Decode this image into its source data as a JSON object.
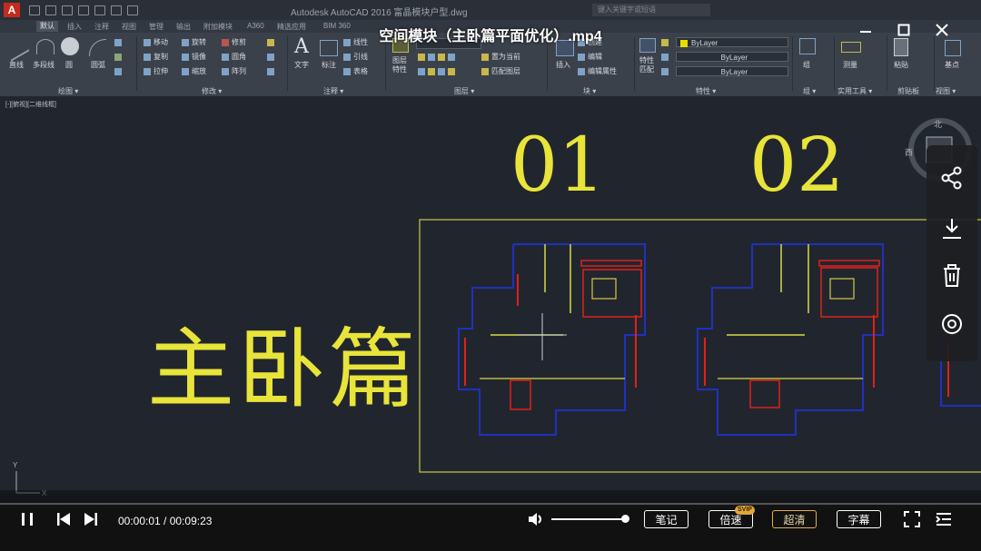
{
  "app": {
    "logo": "A",
    "window_title": "Autodesk AutoCAD 2016     富晶模块户型.dwg",
    "search_placeholder": "键入关键字或短语"
  },
  "ribbon": {
    "tabs": [
      "默认",
      "插入",
      "注释",
      "视图",
      "管理",
      "输出",
      "附加模块",
      "A360",
      "精选应用",
      "BIM 360"
    ],
    "active_tab": "默认",
    "draw": {
      "tools": [
        "直线",
        "多段线",
        "圆",
        "圆弧"
      ],
      "label": "绘图 ▾"
    },
    "modify": {
      "tools": [
        "移动",
        "旋转",
        "修剪",
        "复制",
        "镜像",
        "圆角",
        "拉伸",
        "缩放",
        "阵列"
      ],
      "label": "修改 ▾"
    },
    "annotation": {
      "tools": [
        "文字",
        "标注",
        "线性",
        "引线",
        "表格"
      ],
      "label": "注释 ▾"
    },
    "layers": {
      "tools": [
        "图层特性",
        "置为当前",
        "匹配图层"
      ],
      "label": "图层 ▾"
    },
    "block": {
      "tools": [
        "插入",
        "创建",
        "编辑",
        "编辑属性"
      ],
      "label": "块 ▾"
    },
    "properties": {
      "match": "特性匹配",
      "combos": [
        "ByLayer",
        "ByLayer",
        "ByLayer"
      ],
      "label": "特性 ▾"
    },
    "groups": {
      "tool": "组",
      "label": "组 ▾"
    },
    "utilities": {
      "tool": "测量",
      "label": "实用工具 ▾"
    },
    "clipboard": {
      "tool": "粘贴",
      "label": "剪贴板"
    },
    "view": {
      "tool": "基点",
      "label": "视图 ▾"
    }
  },
  "viewport": {
    "label": "[-][俯视][二维线框]",
    "compass": {
      "north": "北",
      "west": "西"
    },
    "ucs": {
      "x": "X",
      "y": "Y"
    },
    "plan_labels": [
      "01",
      "02"
    ],
    "chapter_title": "主卧篇"
  },
  "colors": {
    "drawing_yellow": "#e8e43a",
    "wall_blue": "#2030c0",
    "wall_red": "#e0201a",
    "ribbon_bg": "#3b414a",
    "viewport_bg": "#21262e",
    "accent_gold": "#e0b04a"
  },
  "video": {
    "title": "空间模块（主卧篇平面优化）.mp4",
    "window_controls": [
      "minimize-icon",
      "maximize-icon",
      "close-icon"
    ]
  },
  "side_panel": {
    "icons": [
      "share-icon",
      "download-icon",
      "delete-icon",
      "eye-icon"
    ]
  },
  "player": {
    "current_time": "00:00:01",
    "duration": "00:09:23",
    "time_display": "00:00:01 / 00:09:23",
    "progress": 0.002,
    "volume": 1.0,
    "buttons": {
      "notes": "笔记",
      "speed": "倍速",
      "speed_badge": "SVIP",
      "quality": "超清",
      "subtitles": "字幕"
    }
  }
}
